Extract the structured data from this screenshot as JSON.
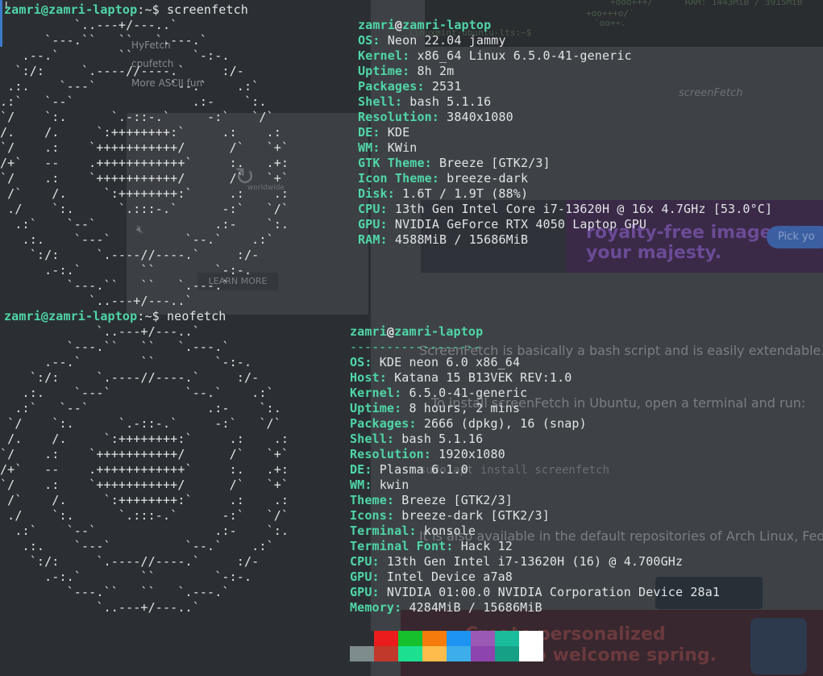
{
  "palette": {
    "accent_green": "#4fd6a8",
    "text": "#e2e4e6",
    "terminal_bg": "#2b2f33",
    "row1": [
      "#2b2f33",
      "#ea1c1c",
      "#15c02c",
      "#f47b0c",
      "#1d94f2",
      "#9b59b6",
      "#1abc9c",
      "#ffffff"
    ],
    "row2": [
      "#7f8c8d",
      "#c0392b",
      "#1ce08f",
      "#fdbc4b",
      "#3daee9",
      "#8e44ad",
      "#16a085",
      "#ffffff"
    ]
  },
  "background": {
    "code_lines": [
      "+ooo+++/`     RAM: 1443MiB / 3915MiB",
      "+oo+++o/`",
      "`oo++.",
      "linuxmint-ubuntu-lts:~$"
    ],
    "heading": "screenFetch",
    "overlay_menu": [
      "HyFetch",
      "cpufetch",
      "More ASCII fun"
    ],
    "learn_more": "LEARN MORE",
    "video_hint": "worldwide",
    "ad_headline": "royalty-free images,\nyour majesty.",
    "ad_button": "Pick yo",
    "para1": "ScreenFetch is basically a bash script and is easily extendable.",
    "para2": "To install screenFetch in Ubuntu, open a terminal and run:",
    "code_cmd": "sudo apt install screenfetch",
    "para3": "It is also available in the default repositories of Arch Linux, Fedora",
    "ad2_text": "Create personalized\ncards to welcome spring."
  },
  "screenfetch": {
    "prompt_user": "zamri@zamri-laptop",
    "prompt_sep": ":~$ ",
    "command": "screenfetch",
    "header_user": "zamri",
    "header_at": "@",
    "header_host": "zamri-laptop",
    "info": [
      {
        "key": "OS:",
        "value": "Neon 22.04 jammy"
      },
      {
        "key": "Kernel:",
        "value": "x86_64 Linux 6.5.0-41-generic"
      },
      {
        "key": "Uptime:",
        "value": "8h 2m"
      },
      {
        "key": "Packages:",
        "value": "2531"
      },
      {
        "key": "Shell:",
        "value": "bash 5.1.16"
      },
      {
        "key": "Resolution:",
        "value": "3840x1080"
      },
      {
        "key": "DE:",
        "value": "KDE"
      },
      {
        "key": "WM:",
        "value": "KWin"
      },
      {
        "key": "GTK Theme:",
        "value": "Breeze [GTK2/3]"
      },
      {
        "key": "Icon Theme:",
        "value": "breeze-dark"
      },
      {
        "key": "Disk:",
        "value": "1.6T / 1.9T (88%)"
      },
      {
        "key": "CPU:",
        "value": "13th Gen Intel Core i7-13620H @ 16x 4.7GHz [53.0°C]"
      },
      {
        "key": "GPU:",
        "value": "NVIDIA GeForce RTX 4050 Laptop GPU"
      },
      {
        "key": "RAM:",
        "value": "4588MiB / 15686MiB"
      }
    ],
    "logo": "          `..---+/---..`\n      `---.``   ``   `.---.`\n   .--.`        ``        `-:-.\n  `:/:     `.----//----.`     :/-\n .:.    `---`          `--.`    .:`\n.:`   `--`                .:-    `:.\n`/    `:.      `.-::-.`     -:`   `/`\n/.    /.     `:++++++++:`     .:    .:\n`/    .:    `+++++++++++/      /`   `+`\n/+`   --    .++++++++++++`     :.   .+:\n`/    .:    `+++++++++++/      /`   `+`\n /`    /.     `:++++++++:`     .:    .:\n ./    `:.      `.:::-.`      -:`   `/`\n  .:`    `--`                .:-    `:.\n   .:.    `---`          `--.`    .:`\n    `:/:     `.----//----.`     :/-\n      .-:.`        ``        `-:-.\n         `---.``   ``   `.---.`\n            `..---+/---..`"
  },
  "neofetch": {
    "prompt_user": "zamri@zamri-laptop",
    "prompt_sep": ":~$ ",
    "command": "neofetch",
    "header_user": "zamri",
    "header_at": "@",
    "header_host": "zamri-laptop",
    "underline": "------------------",
    "info": [
      {
        "key": "OS:",
        "value": "KDE neon 6.0 x86_64"
      },
      {
        "key": "Host:",
        "value": "Katana 15 B13VEK REV:1.0"
      },
      {
        "key": "Kernel:",
        "value": "6.5.0-41-generic"
      },
      {
        "key": "Uptime:",
        "value": "8 hours, 2 mins"
      },
      {
        "key": "Packages:",
        "value": "2666 (dpkg), 16 (snap)"
      },
      {
        "key": "Shell:",
        "value": "bash 5.1.16"
      },
      {
        "key": "Resolution:",
        "value": "1920x1080"
      },
      {
        "key": "DE:",
        "value": "Plasma 6.1.0"
      },
      {
        "key": "WM:",
        "value": "kwin"
      },
      {
        "key": "Theme:",
        "value": "Breeze [GTK2/3]"
      },
      {
        "key": "Icons:",
        "value": "breeze-dark [GTK2/3]"
      },
      {
        "key": "Terminal:",
        "value": "konsole"
      },
      {
        "key": "Terminal Font:",
        "value": "Hack 12"
      },
      {
        "key": "CPU:",
        "value": "13th Gen Intel i7-13620H (16) @ 4.700GHz"
      },
      {
        "key": "GPU:",
        "value": "Intel Device a7a8"
      },
      {
        "key": "GPU:",
        "value": "NVIDIA 01:00.0 NVIDIA Corporation Device 28a1"
      },
      {
        "key": "Memory:",
        "value": "4284MiB / 15686MiB"
      }
    ],
    "logo": "             `..---+/---..`\n         `---.``   ``   `.---.`\n      .--.`        ``        `-:-.\n    `:/:     `.----//----.`     :/-\n   .:.    `---`          `--.`    .:`\n  .:`   `--`                .:-    `:.\n `/    `:.      `.-::-.`     -:`   `/`\n /.    /.     `:++++++++:`     .:    .:\n`/    .:    `+++++++++++/      /`   `+`\n/+`   --    .++++++++++++`     :.   .+:\n`/    .:    `+++++++++++/      /`   `+`\n /`    /.     `:++++++++:`     .:    .:\n ./    `:.      `.:::-.`      -:`   `/`\n  .:`    `--`                .:-    `:.\n   .:.    `---`          `--.`    .:`\n    `:/:     `.----//----.`     :/-\n      .-:.`        ``        `-:-.\n         `---.``   ``   `.---.`\n             `..---+/---..`"
  }
}
